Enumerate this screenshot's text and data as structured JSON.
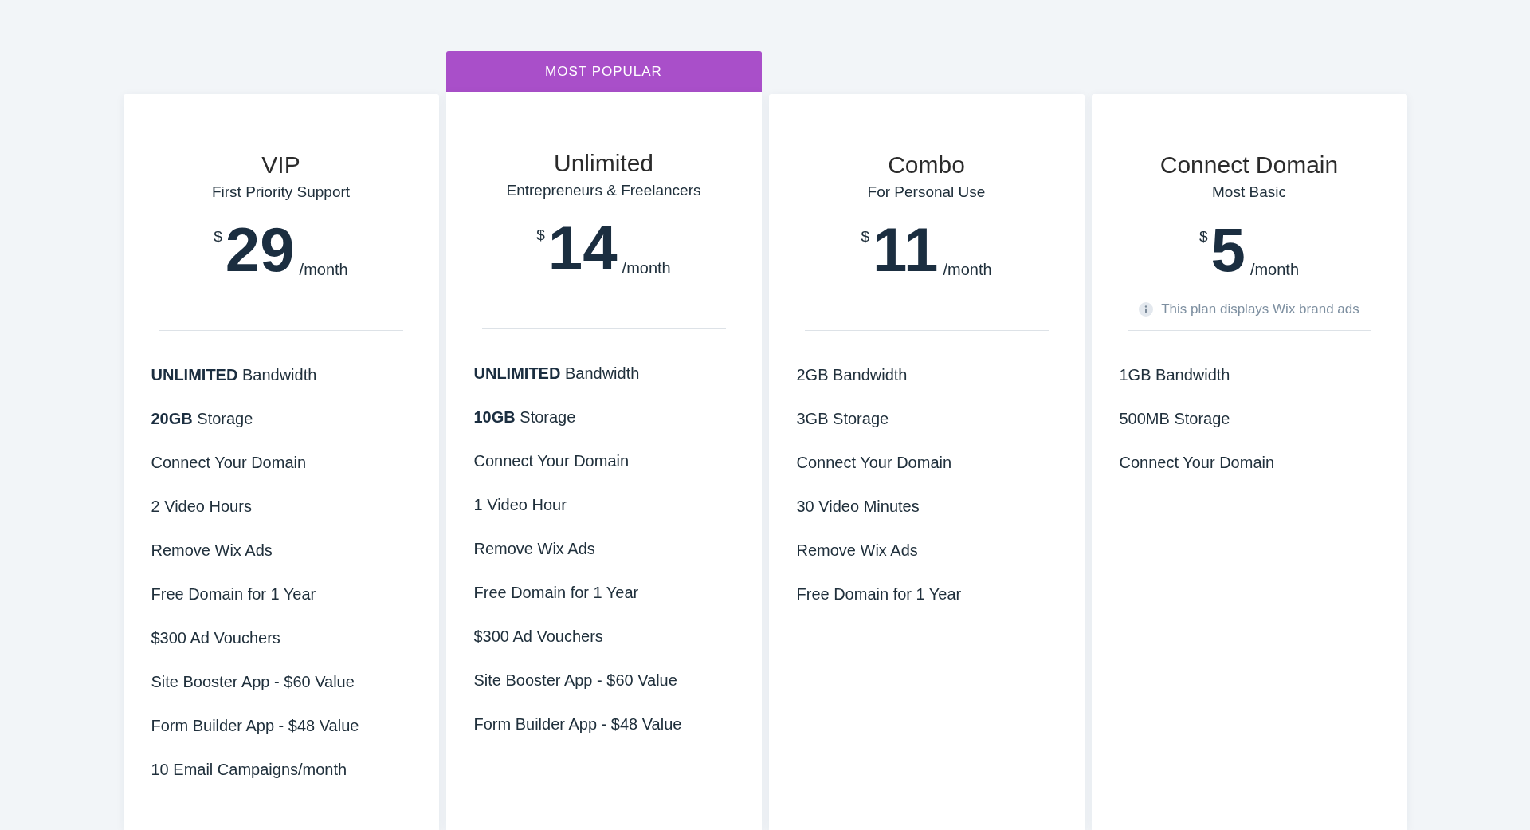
{
  "plans": [
    {
      "name": "VIP",
      "subtitle": "First Priority Support",
      "currency": "$",
      "price": "29",
      "period": "/month",
      "features": [
        "**UNLIMITED** Bandwidth",
        "**20GB** Storage",
        "Connect Your Domain",
        "2 Video Hours",
        "Remove Wix Ads",
        "Free Domain for 1 Year",
        "$300 Ad Vouchers",
        "Site Booster App - $60 Value",
        "Form Builder App - $48 Value",
        "10 Email Campaigns/month"
      ]
    },
    {
      "badge": "MOST POPULAR",
      "name": "Unlimited",
      "subtitle": "Entrepreneurs & Freelancers",
      "currency": "$",
      "price": "14",
      "period": "/month",
      "features": [
        "**UNLIMITED** Bandwidth",
        "**10GB** Storage",
        "Connect Your Domain",
        "1 Video Hour",
        "Remove Wix Ads",
        "Free Domain for 1 Year",
        "$300 Ad Vouchers",
        "Site Booster App - $60 Value",
        "Form Builder App - $48 Value"
      ]
    },
    {
      "name": "Combo",
      "subtitle": "For Personal Use",
      "currency": "$",
      "price": "11",
      "period": "/month",
      "features": [
        "2GB Bandwidth",
        "3GB Storage",
        "Connect Your Domain",
        "30 Video Minutes",
        "Remove Wix Ads",
        "Free Domain for 1 Year"
      ]
    },
    {
      "name": "Connect Domain",
      "subtitle": "Most Basic",
      "currency": "$",
      "price": "5",
      "period": "/month",
      "note": "This plan displays Wix brand ads",
      "features": [
        "1GB Bandwidth",
        "500MB Storage",
        "Connect Your Domain"
      ]
    }
  ]
}
